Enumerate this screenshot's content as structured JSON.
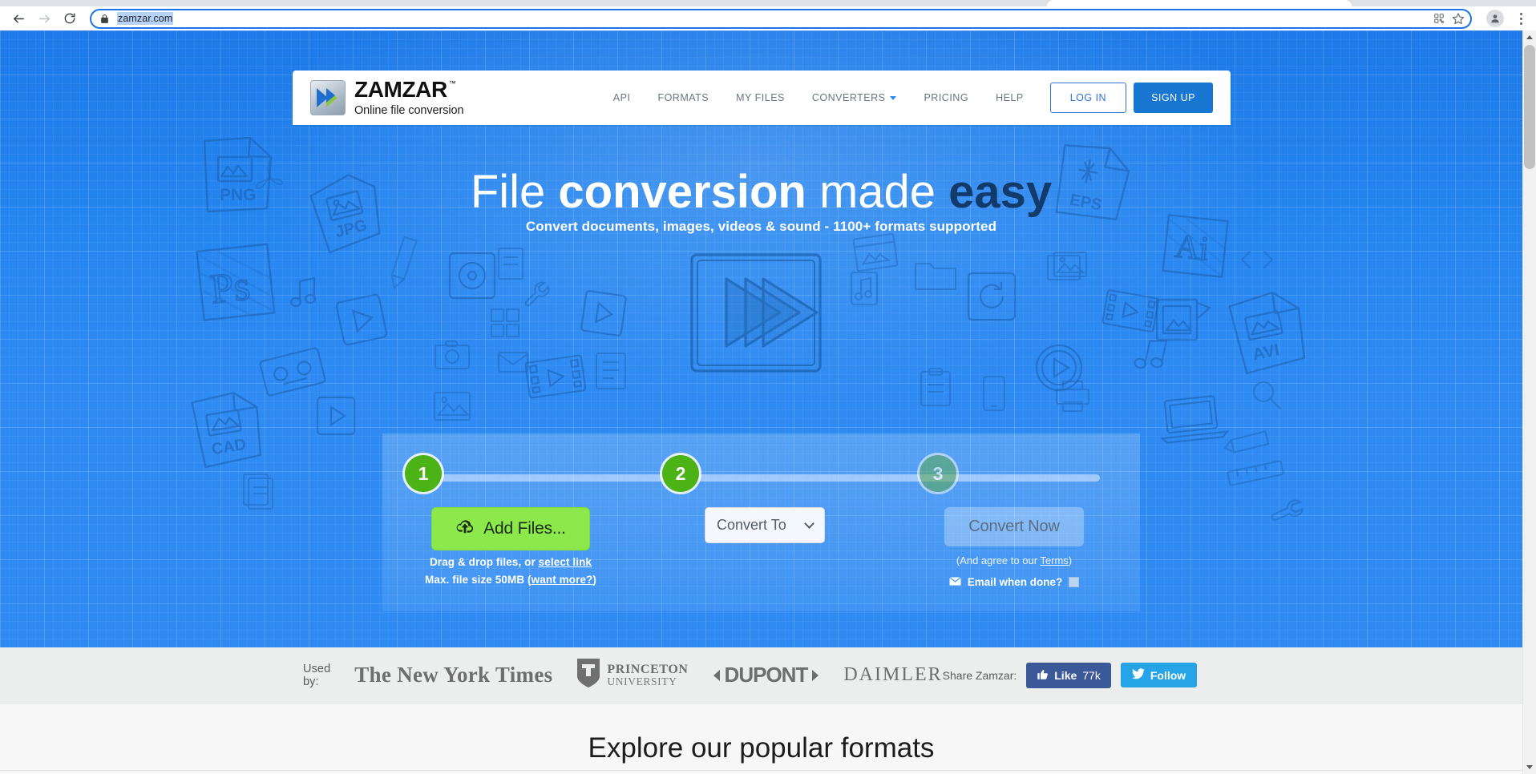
{
  "browser": {
    "back_icon": "back-arrow-icon",
    "forward_icon": "forward-arrow-icon",
    "reload_icon": "reload-icon",
    "lock_icon": "lock-icon",
    "url": "zamzar.com",
    "qr_icon": "qr-code-icon",
    "bookmark_icon": "star-icon",
    "profile_icon": "profile-avatar-icon",
    "menu_icon": "three-dot-menu-icon"
  },
  "header": {
    "logo_mark": "zamzar-chevron-logo-icon",
    "wordmark": "ZAMZAR",
    "trademark": "™",
    "tagline": "Online file conversion",
    "nav": [
      {
        "label": "API"
      },
      {
        "label": "FORMATS"
      },
      {
        "label": "MY FILES"
      },
      {
        "label": "CONVERTERS",
        "has_caret": true
      },
      {
        "label": "PRICING"
      },
      {
        "label": "HELP"
      }
    ],
    "login_label": "LOG IN",
    "signup_label": "SIGN UP",
    "signup_color": "#1877d2"
  },
  "hero": {
    "title_part1": "File ",
    "title_part2": "conversion",
    "title_part3": " made ",
    "title_part4": "easy",
    "subtitle": "Convert documents, images, videos & sound - 1100+ formats supported",
    "play_icon": "triple-triangle-play-icon",
    "background_color": "#2f8bf2",
    "accent_dark": "#123a6b",
    "doodle_labels": [
      "PNG",
      "JPG",
      "PS",
      "CAD",
      "EPS",
      "Ai",
      "AVI"
    ]
  },
  "widget": {
    "steps": [
      {
        "number": "1",
        "state": "active"
      },
      {
        "number": "2",
        "state": "active"
      },
      {
        "number": "3",
        "state": "disabled"
      }
    ],
    "step_color": "#4cb316",
    "add_files_label": "Add Files...",
    "add_files_icon": "cloud-upload-icon",
    "add_files_color": "#8ce84b",
    "drag_text_prefix": "Drag & drop files, or ",
    "drag_link": "select link",
    "maxsize_prefix": "Max. file size 50MB (",
    "maxsize_link": "want more?",
    "maxsize_suffix": ")",
    "convert_to_label": "Convert To",
    "convert_to_caret": "chevron-down-icon",
    "convert_now_label": "Convert Now",
    "terms_prefix": "(And agree to our ",
    "terms_link": "Terms",
    "terms_suffix": ")",
    "email_icon": "envelope-icon",
    "email_label": "Email when done?",
    "email_checked": false
  },
  "usedby": {
    "label": "Used by:",
    "clients": [
      {
        "name": "The New York Times",
        "icon": "nyt-logo"
      },
      {
        "name": "PRINCETON",
        "name2": "UNIVERSITY",
        "icon": "princeton-shield-icon"
      },
      {
        "name": "DUPONT",
        "icon": "dupont-logo"
      },
      {
        "name": "DAIMLER",
        "icon": "daimler-logo"
      }
    ],
    "share_label": "Share Zamzar:",
    "like_label": "Like",
    "like_count": "77k",
    "like_icon": "thumbs-up-icon",
    "like_color": "#3b5998",
    "follow_label": "Follow",
    "follow_icon": "twitter-bird-icon",
    "follow_color": "#25a5e8"
  },
  "below_fold": {
    "heading": "Explore our popular formats"
  }
}
